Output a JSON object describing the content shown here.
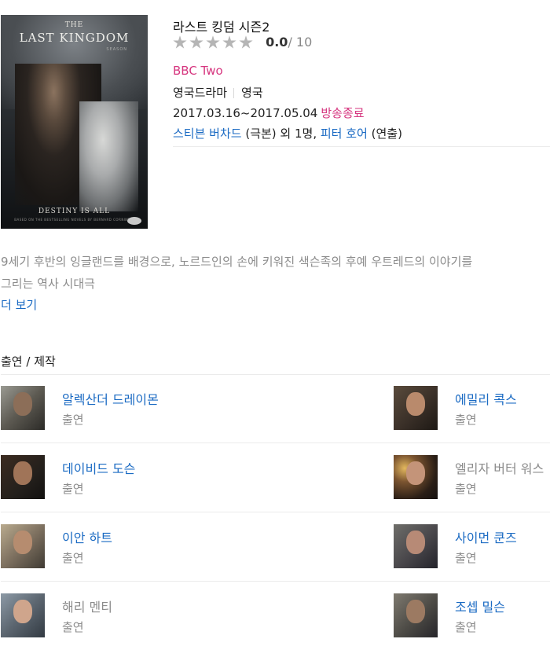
{
  "poster": {
    "the": "THE",
    "title": "LAST KINGDOM",
    "season": "SEASON",
    "tagline": "DESTINY IS ALL",
    "credit": "BASED ON THE BESTSELLING NOVELS BY BERNARD CORNWELL"
  },
  "show": {
    "title": "라스트 킹덤 시즌2",
    "rating": {
      "stars_filled": 0,
      "stars_total": 5,
      "score": "0.0",
      "max": "/ 10"
    },
    "network": "BBC Two",
    "genre": "영국드라마",
    "country": "영국",
    "date_range": "2017.03.16~2017.05.04",
    "status": "방송종료",
    "credits": {
      "writer": "스티븐 버차드",
      "writer_role": " (극본) 외 1명, ",
      "director": "피터 호어",
      "director_role": " (연출)"
    }
  },
  "synopsis": {
    "line1": "9세기 후반의 잉글랜드를 배경으로, 노르드인의 손에 키워진 색슨족의 후예 우트레드의 이야기를",
    "line2": "그리는 역사 시대극",
    "more_label": "더 보기"
  },
  "cast_section": {
    "title": "출연 / 제작",
    "items": [
      {
        "name": "알렉산더 드레이몬",
        "role": "출연",
        "linked": true
      },
      {
        "name": "에밀리 콕스",
        "role": "출연",
        "linked": true
      },
      {
        "name": "데이비드 도슨",
        "role": "출연",
        "linked": true
      },
      {
        "name": "엘리자 버터 워스",
        "role": "출연",
        "linked": false
      },
      {
        "name": "이안 하트",
        "role": "출연",
        "linked": true
      },
      {
        "name": "사이먼 쿤즈",
        "role": "출연",
        "linked": true
      },
      {
        "name": "해리 멘티",
        "role": "출연",
        "linked": false
      },
      {
        "name": "조셉 밀슨",
        "role": "출연",
        "linked": true
      }
    ]
  },
  "colors": {
    "link": "#1a6ac3",
    "accent": "#d6367f",
    "muted": "#8c8c8c",
    "star": "#b5b5b5"
  }
}
